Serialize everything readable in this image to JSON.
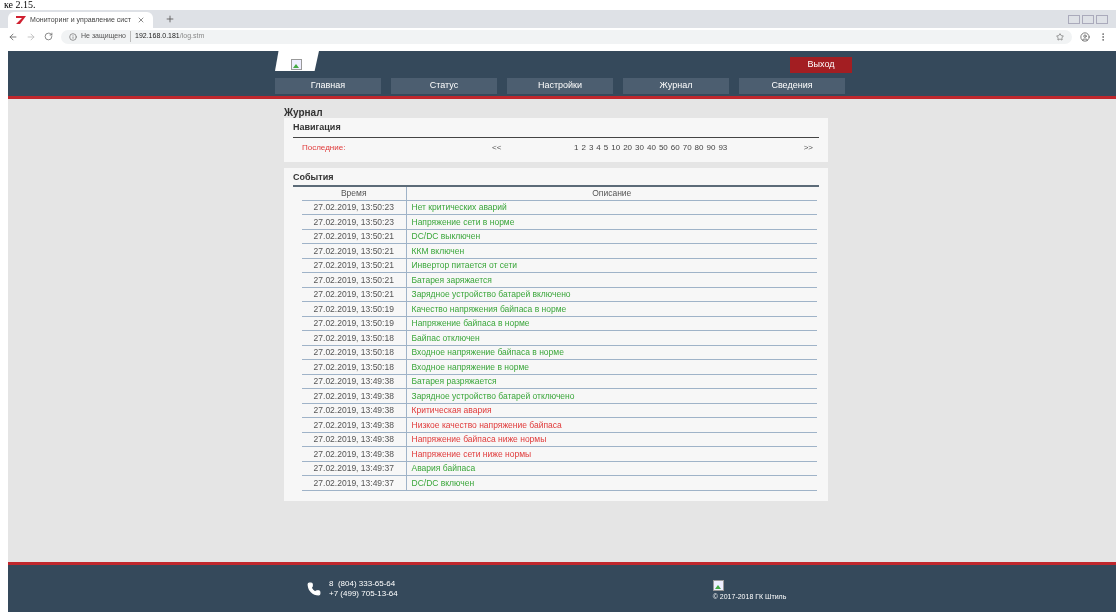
{
  "document_caption": "ке 2.15.",
  "browser": {
    "tab_title": "Мониторинг и управление сист",
    "security": "Не защищено",
    "url_host": "192.168.0.181",
    "url_path": "/log.stm"
  },
  "header": {
    "logout": "Выход",
    "nav": [
      {
        "label": "Главная",
        "selected": false
      },
      {
        "label": "Статус",
        "selected": false
      },
      {
        "label": "Настройки",
        "selected": false
      },
      {
        "label": "Журнал",
        "selected": false
      },
      {
        "label": "Сведения",
        "selected": false
      }
    ]
  },
  "page_title": "Журнал",
  "navigation": {
    "title": "Навигация",
    "latest": "Последние:",
    "prev": "<<",
    "pages": [
      "1",
      "2",
      "3",
      "4",
      "5",
      "10",
      "20",
      "30",
      "40",
      "50",
      "60",
      "70",
      "80",
      "90",
      "93"
    ],
    "next": ">>"
  },
  "events": {
    "title": "События",
    "columns": [
      "Время",
      "Описание"
    ],
    "rows": [
      {
        "time": "27.02.2019, 13:50:23",
        "description": "Нет критических аварий",
        "kind": "normal"
      },
      {
        "time": "27.02.2019, 13:50:23",
        "description": "Напряжение сети в норме",
        "kind": "normal"
      },
      {
        "time": "27.02.2019, 13:50:21",
        "description": "DC/DC выключен",
        "kind": "normal"
      },
      {
        "time": "27.02.2019, 13:50:21",
        "description": "ККМ включен",
        "kind": "normal"
      },
      {
        "time": "27.02.2019, 13:50:21",
        "description": "Инвертор питается от сети",
        "kind": "normal"
      },
      {
        "time": "27.02.2019, 13:50:21",
        "description": "Батарея заряжается",
        "kind": "normal"
      },
      {
        "time": "27.02.2019, 13:50:21",
        "description": "Зарядное устройство батарей включено",
        "kind": "normal"
      },
      {
        "time": "27.02.2019, 13:50:19",
        "description": "Качество напряжения байпаса в норме",
        "kind": "normal"
      },
      {
        "time": "27.02.2019, 13:50:19",
        "description": "Напряжение байпаса в норме",
        "kind": "normal"
      },
      {
        "time": "27.02.2019, 13:50:18",
        "description": "Байпас отключен",
        "kind": "normal"
      },
      {
        "time": "27.02.2019, 13:50:18",
        "description": "Входное напряжение байпаса в норме",
        "kind": "normal"
      },
      {
        "time": "27.02.2019, 13:50:18",
        "description": "Входное напряжение в норме",
        "kind": "normal"
      },
      {
        "time": "27.02.2019, 13:49:38",
        "description": "Батарея разряжается",
        "kind": "normal"
      },
      {
        "time": "27.02.2019, 13:49:38",
        "description": "Зарядное устройство батарей отключено",
        "kind": "normal"
      },
      {
        "time": "27.02.2019, 13:49:38",
        "description": "Критическая авария",
        "kind": "alarm"
      },
      {
        "time": "27.02.2019, 13:49:38",
        "description": "Низкое качество напряжение байпаса",
        "kind": "alarm"
      },
      {
        "time": "27.02.2019, 13:49:38",
        "description": "Напряжение байпаса ниже нормы",
        "kind": "alarm"
      },
      {
        "time": "27.02.2019, 13:49:38",
        "description": "Напряжение сети ниже нормы",
        "kind": "alarm"
      },
      {
        "time": "27.02.2019, 13:49:37",
        "description": "Авария байпаса",
        "kind": "normal"
      },
      {
        "time": "27.02.2019, 13:49:37",
        "description": "DC/DC включен",
        "kind": "normal"
      }
    ]
  },
  "footer": {
    "phones": [
      "8  (804) 333-65-64",
      "+7 (499) 705-13-64"
    ],
    "copyright": "© 2017-2018 ГК Штиль"
  }
}
